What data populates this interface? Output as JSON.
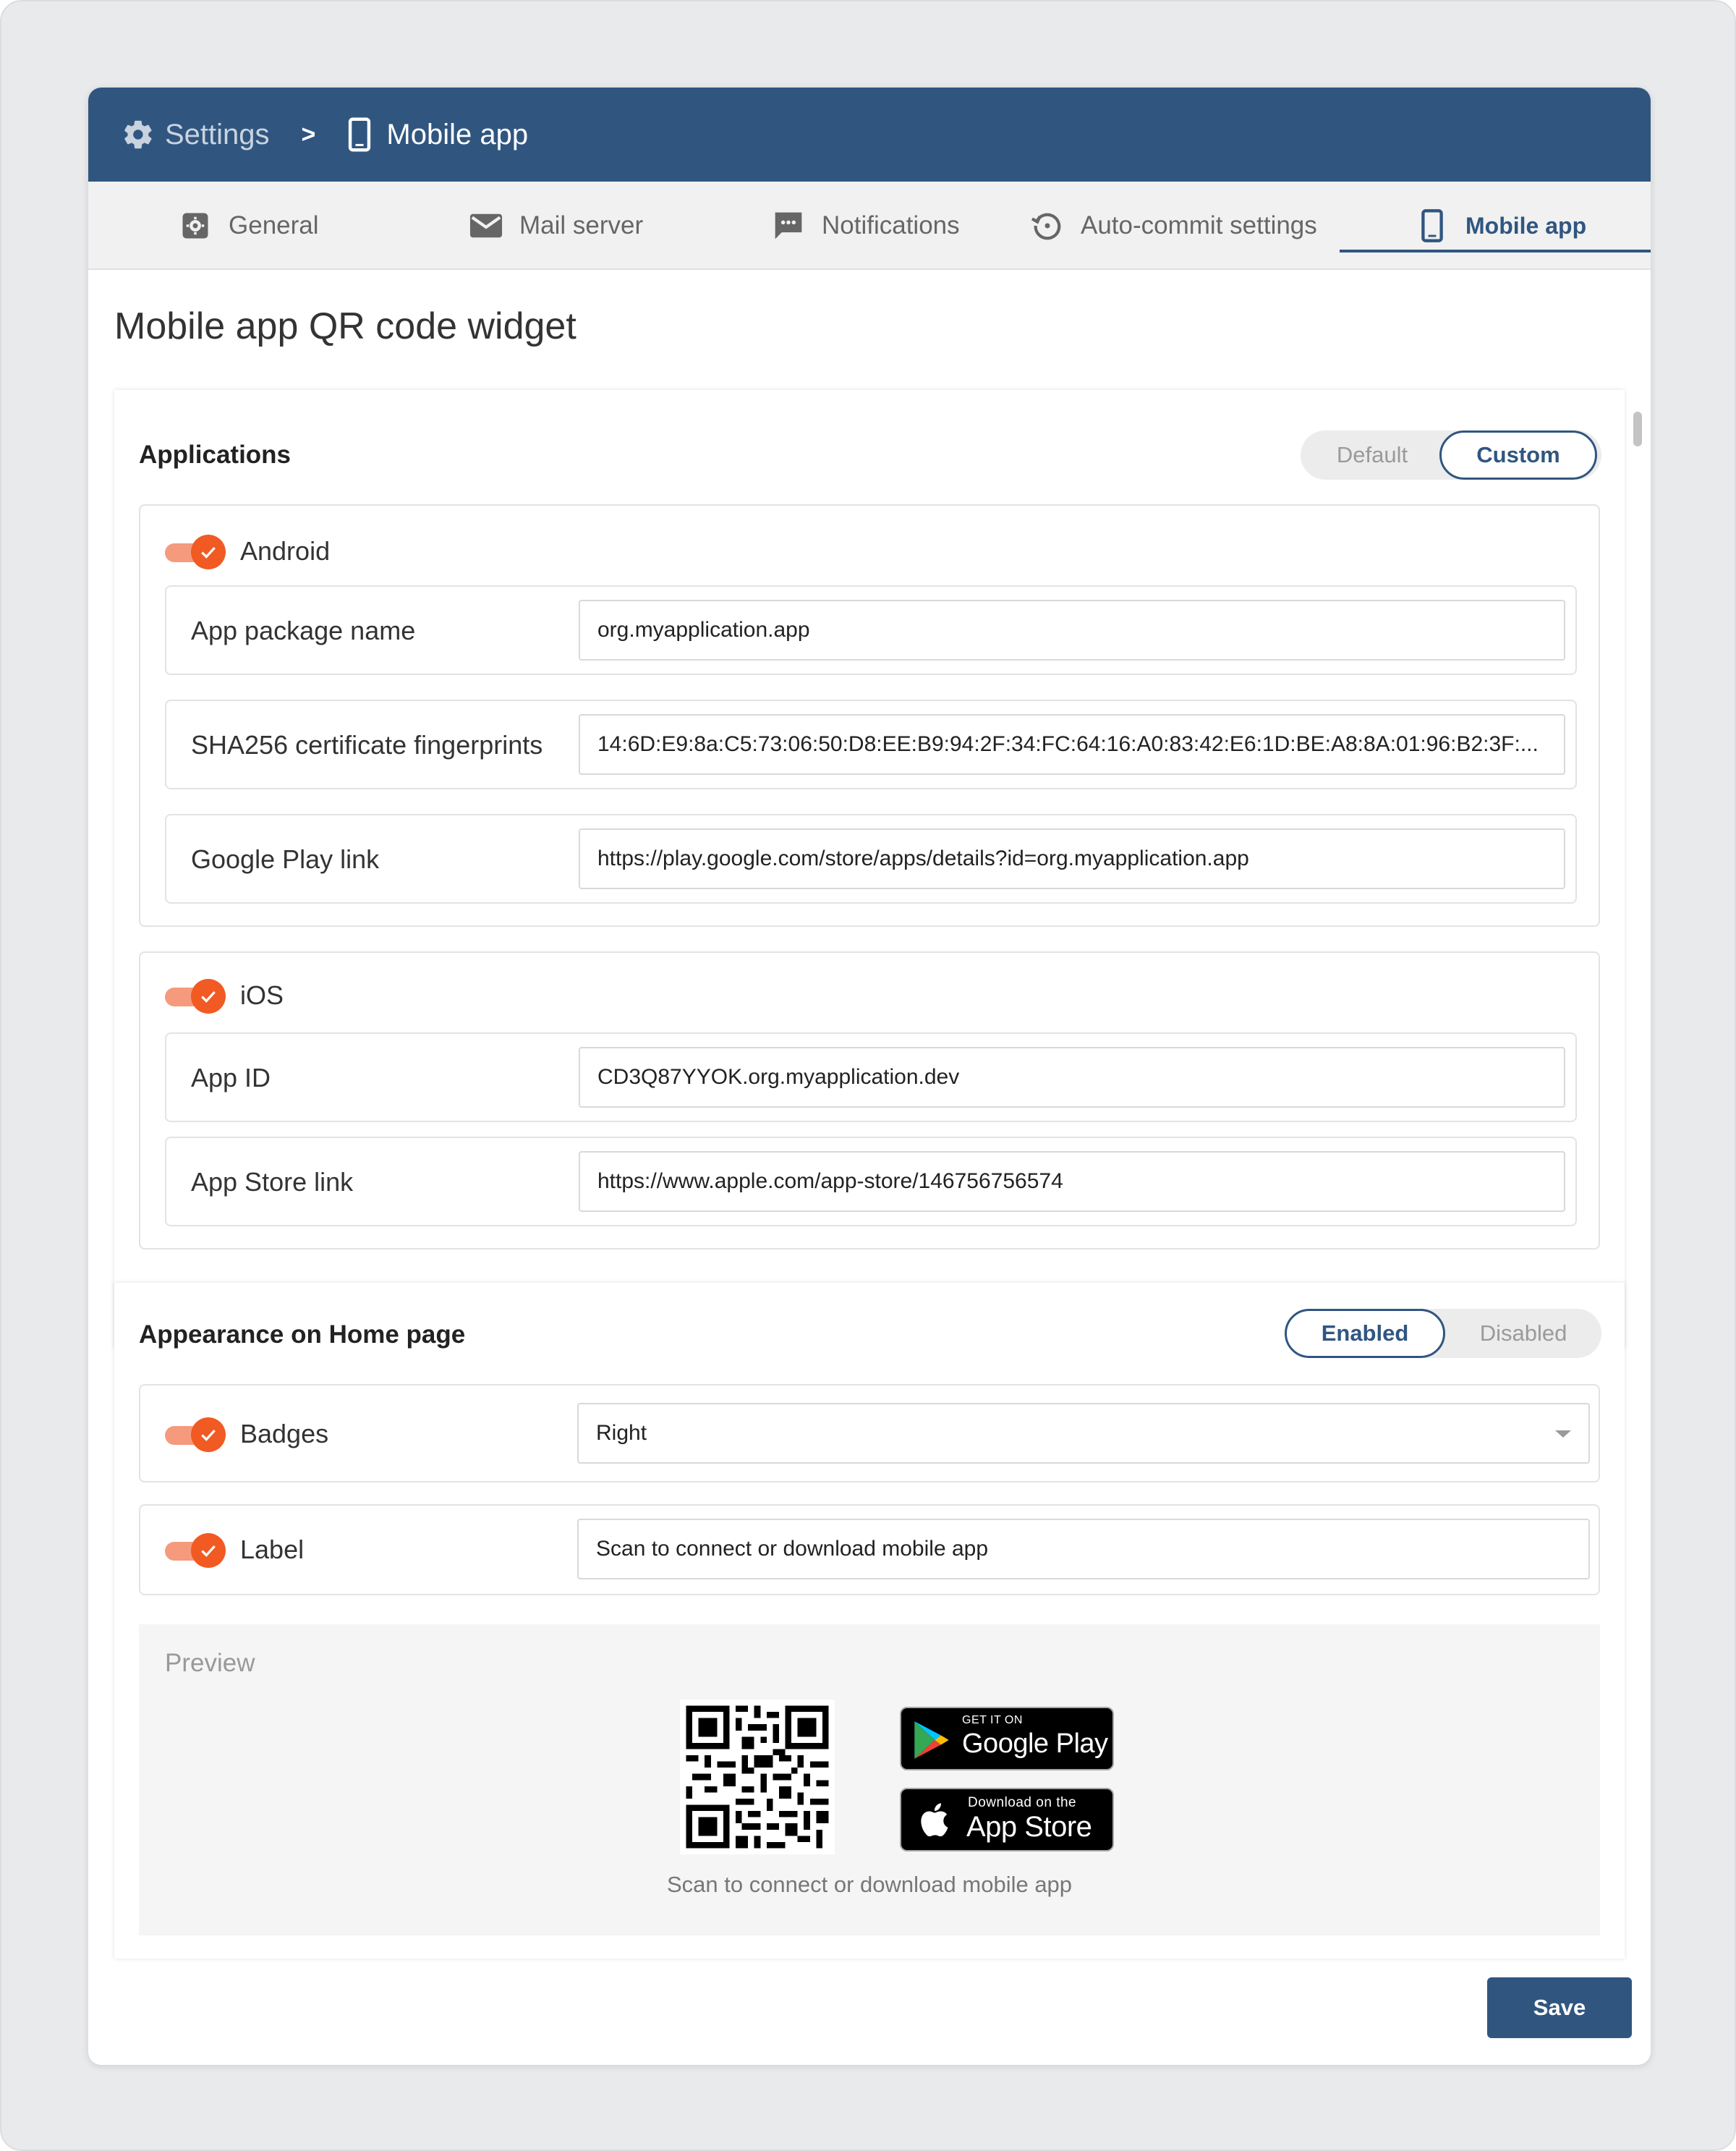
{
  "header": {
    "breadcrumb_root": "Settings",
    "breadcrumb_separator": ">",
    "breadcrumb_current": "Mobile app",
    "root_icon": "gear-icon",
    "current_icon": "smartphone-icon"
  },
  "tabs": [
    {
      "label": "General",
      "icon": "settings-square-icon"
    },
    {
      "label": "Mail server",
      "icon": "envelope-icon"
    },
    {
      "label": "Notifications",
      "icon": "chat-bubble-icon"
    },
    {
      "label": "Auto-commit settings",
      "icon": "history-icon"
    },
    {
      "label": "Mobile app",
      "icon": "smartphone-icon",
      "active": true
    }
  ],
  "page_title": "Mobile app QR code widget",
  "applications": {
    "title": "Applications",
    "mode_options": [
      "Default",
      "Custom"
    ],
    "mode_selected": "Custom",
    "android": {
      "label": "Android",
      "enabled": true,
      "fields": [
        {
          "label": "App package name",
          "value": "org.myapplication.app"
        },
        {
          "label": "SHA256 certificate fingerprints",
          "value": "14:6D:E9:8a:C5:73:06:50:D8:EE:B9:94:2F:34:FC:64:16:A0:83:42:E6:1D:BE:A8:8A:01:96:B2:3F:..."
        },
        {
          "label": "Google Play link",
          "value": "https://play.google.com/store/apps/details?id=org.myapplication.app"
        }
      ]
    },
    "ios": {
      "label": "iOS",
      "enabled": true,
      "fields": [
        {
          "label": "App ID",
          "value": "CD3Q87YYOK.org.myapplication.dev"
        },
        {
          "label": "App Store link",
          "value": "https://www.apple.com/app-store/146756756574"
        }
      ]
    }
  },
  "appearance": {
    "title": "Appearance on Home page",
    "state_options": [
      "Enabled",
      "Disabled"
    ],
    "state_selected": "Enabled",
    "badges": {
      "label": "Badges",
      "enabled": true,
      "value": "Right"
    },
    "label_row": {
      "label": "Label",
      "enabled": true,
      "value": "Scan to connect or download mobile app"
    },
    "preview": {
      "label": "Preview",
      "caption": "Scan to connect or download mobile app",
      "google_badge": {
        "small": "GET IT ON",
        "big": "Google Play"
      },
      "apple_badge": {
        "small": "Download on the",
        "big": "App Store"
      }
    }
  },
  "save_label": "Save",
  "colors": {
    "header_bg": "#305680",
    "accent": "#f15a22",
    "toggle_track": "#f59a7d"
  }
}
